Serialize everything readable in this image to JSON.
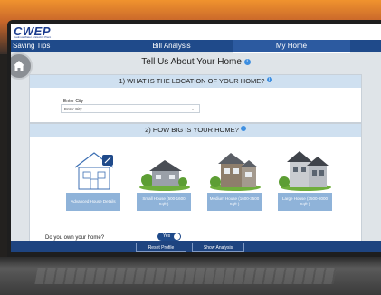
{
  "brand": {
    "logo": "CWEP",
    "subtitle": "Cadmus Water & Electric Plant"
  },
  "nav": {
    "tabs": [
      "Saving Tips",
      "Bill Analysis",
      "My Home"
    ],
    "active": "My Home"
  },
  "page": {
    "title": "Tell Us About Your Home",
    "info_glyph": "i"
  },
  "section1": {
    "heading": "1) WHAT IS THE LOCATION OF YOUR HOME?",
    "field_label": "Enter City",
    "select_value": "Enter City"
  },
  "section2": {
    "heading": "2) HOW BIG IS YOUR HOME?",
    "houses": [
      {
        "label": "Advanced House Details"
      },
      {
        "label": "Small House (500-1600 Sqft.)"
      },
      {
        "label": "Medium House (1600-3500 Sqft.)"
      },
      {
        "label": "Large House (3500-8000 Sqft.)"
      }
    ]
  },
  "ownership": {
    "question": "Do you own your home?",
    "toggle_label": "Yes"
  },
  "footer": {
    "reset_label": "Reset Profile",
    "show_label": "Show Analysis"
  },
  "colors": {
    "nav": "#1f4a8a",
    "accent_blue": "#3d8ee0",
    "card_header": "#cfe0f0",
    "house_label": "#8fb3d9"
  }
}
